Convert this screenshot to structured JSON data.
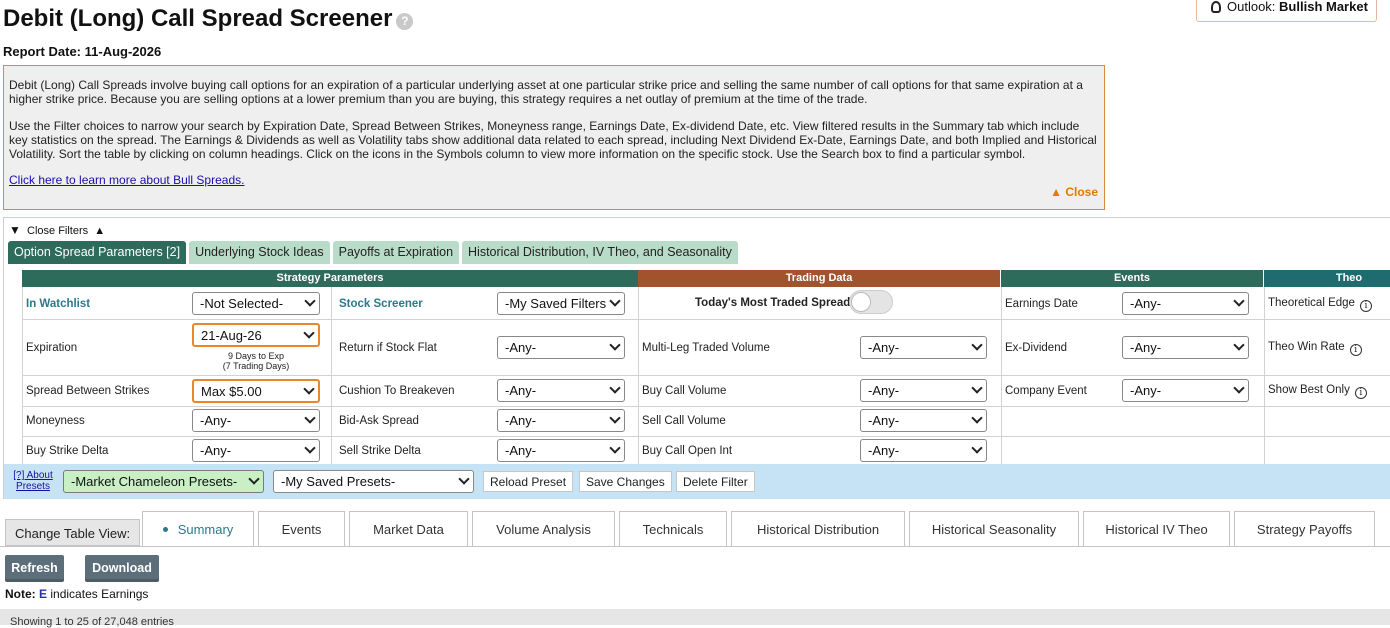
{
  "page": {
    "title": "Debit (Long) Call Spread Screener",
    "help_icon": "?",
    "report_label": "Report Date:",
    "report_date": "11-Aug-2026",
    "outlook_label": "Outlook:",
    "outlook_value": "Bullish Market"
  },
  "info": {
    "para1": "Debit (Long) Call Spreads involve buying call options for an expiration of a particular underlying asset at one particular strike price and selling the same number of call options for that same expiration at a higher strike price. Because you are selling options at a lower premium than you are buying, this strategy requires a net outlay of premium at the time of the trade.",
    "para2": "Use the Filter choices to narrow your search by Expiration Date, Spread Between Strikes, Moneyness range, Earnings Date, Ex-dividend Date, etc. View filtered results in the Summary tab which include key statistics on the spread. The Earnings & Dividends as well as Volatility tabs show additional data related to each spread, including Next Dividend Ex-Date, Earnings Date, and both Implied and Historical Volatility. Sort the table by clicking on column headings. Click on the icons in the Symbols column to view more information on the specific stock. Use the Search box to find a particular symbol.",
    "learn_link": "Click here to learn more about Bull Spreads.",
    "close_label": "▲ Close"
  },
  "filters": {
    "close_filters_label": "Close Filters",
    "tabs": [
      {
        "label": "Option Spread Parameters [2]"
      },
      {
        "label": "Underlying Stock Ideas"
      },
      {
        "label": "Payoffs at Expiration"
      },
      {
        "label": "Historical Distribution, IV Theo, and Seasonality"
      }
    ],
    "sections": {
      "strategy": "Strategy Parameters",
      "trading": "Trading Data",
      "events": "Events",
      "theo": "Theo"
    },
    "colors": {
      "strategy": "#2e6b5a",
      "trading": "#a0532d",
      "events": "#2e6b5a",
      "theo": "#1e6b70"
    },
    "labels": {
      "in_watchlist": "In Watchlist",
      "stock_screener": "Stock Screener",
      "todays_most_traded": "Today's Most Traded Spreads",
      "earnings_date": "Earnings Date",
      "theoretical_edge": "Theoretical Edge",
      "expiration": "Expiration",
      "return_if_flat": "Return if Stock Flat",
      "multi_leg_volume": "Multi-Leg Traded Volume",
      "ex_dividend": "Ex-Dividend",
      "theo_win_rate": "Theo Win Rate",
      "spread_between_strikes": "Spread Between Strikes",
      "cushion_to_breakeven": "Cushion To Breakeven",
      "buy_call_volume": "Buy Call Volume",
      "company_event": "Company Event",
      "show_best_only": "Show Best Only",
      "moneyness": "Moneyness",
      "bid_ask_spread": "Bid-Ask Spread",
      "sell_call_volume": "Sell Call Volume",
      "buy_strike_delta": "Buy Strike Delta",
      "sell_strike_delta": "Sell Strike Delta",
      "buy_call_open_int": "Buy Call Open Int"
    },
    "values": {
      "in_watchlist": "-Not Selected-",
      "stock_screener": "-My Saved Filters",
      "earnings_date": "-Any-",
      "expiration": "21-Aug-26",
      "expiration_note1": "9 Days to Exp",
      "expiration_note2": "(7 Trading Days)",
      "return_if_flat": "-Any-",
      "multi_leg_volume": "-Any-",
      "ex_dividend": "-Any-",
      "spread_between_strikes": "Max $5.00",
      "cushion_to_breakeven": "-Any-",
      "buy_call_volume": "-Any-",
      "company_event": "-Any-",
      "moneyness": "-Any-",
      "bid_ask_spread": "-Any-",
      "sell_call_volume": "-Any-",
      "buy_strike_delta": "-Any-",
      "sell_strike_delta": "-Any-",
      "buy_call_open_int": "-Any-"
    },
    "presets": {
      "about_line1": "[?] About",
      "about_line2": "Presets",
      "market_presets": "-Market Chameleon Presets-",
      "saved_presets": "-My Saved Presets-",
      "reload": "Reload Preset",
      "save": "Save Changes",
      "delete": "Delete Filter"
    }
  },
  "views": {
    "change_label": "Change Table View:",
    "tabs": [
      {
        "label": "Summary"
      },
      {
        "label": "Events"
      },
      {
        "label": "Market Data"
      },
      {
        "label": "Volume Analysis"
      },
      {
        "label": "Technicals"
      },
      {
        "label": "Historical Distribution"
      },
      {
        "label": "Historical Seasonality"
      },
      {
        "label": "Historical IV Theo"
      },
      {
        "label": "Strategy Payoffs"
      }
    ]
  },
  "actions": {
    "refresh": "Refresh",
    "download": "Download"
  },
  "note": {
    "label": "Note:",
    "e": "E",
    "text": "indicates Earnings"
  },
  "entries_text": "Showing 1 to 25 of 27,048 entries"
}
